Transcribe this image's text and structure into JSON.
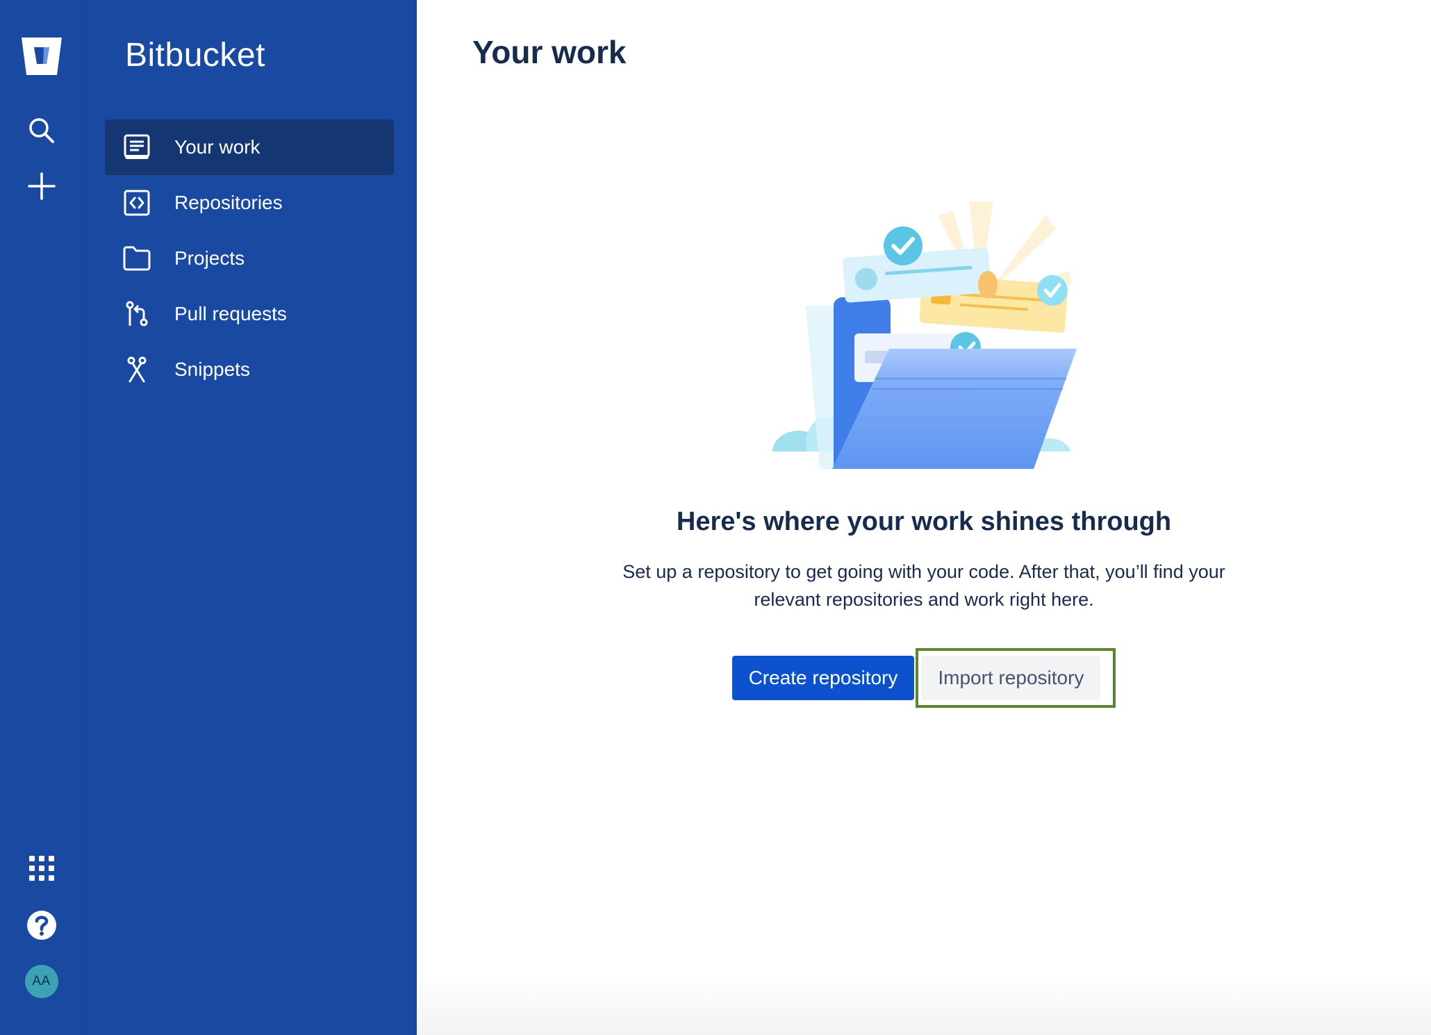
{
  "global_nav": {
    "logo_icon": "bitbucket-logo-icon",
    "search_icon": "search-icon",
    "create_icon": "plus-icon",
    "apps_icon": "app-switcher-icon",
    "help_icon": "help-icon",
    "avatar_initials": "AA"
  },
  "product_nav": {
    "title": "Bitbucket",
    "items": [
      {
        "label": "Your work",
        "icon": "your-work-icon",
        "active": true
      },
      {
        "label": "Repositories",
        "icon": "repositories-icon",
        "active": false
      },
      {
        "label": "Projects",
        "icon": "folder-icon",
        "active": false
      },
      {
        "label": "Pull requests",
        "icon": "pull-request-icon",
        "active": false
      },
      {
        "label": "Snippets",
        "icon": "scissors-icon",
        "active": false
      }
    ]
  },
  "main": {
    "title": "Your work",
    "empty_state": {
      "heading": "Here's where your work shines through",
      "description": "Set up a repository to get going with your code. After that, you’ll find your relevant repositories and work right here.",
      "create_button": "Create repository",
      "import_button": "Import repository"
    }
  },
  "colors": {
    "nav_background": "#1949a0",
    "nav_active": "#143774",
    "primary_button": "#0c52cc",
    "highlight_border": "#5b8533",
    "text_dark": "#172b4d"
  }
}
